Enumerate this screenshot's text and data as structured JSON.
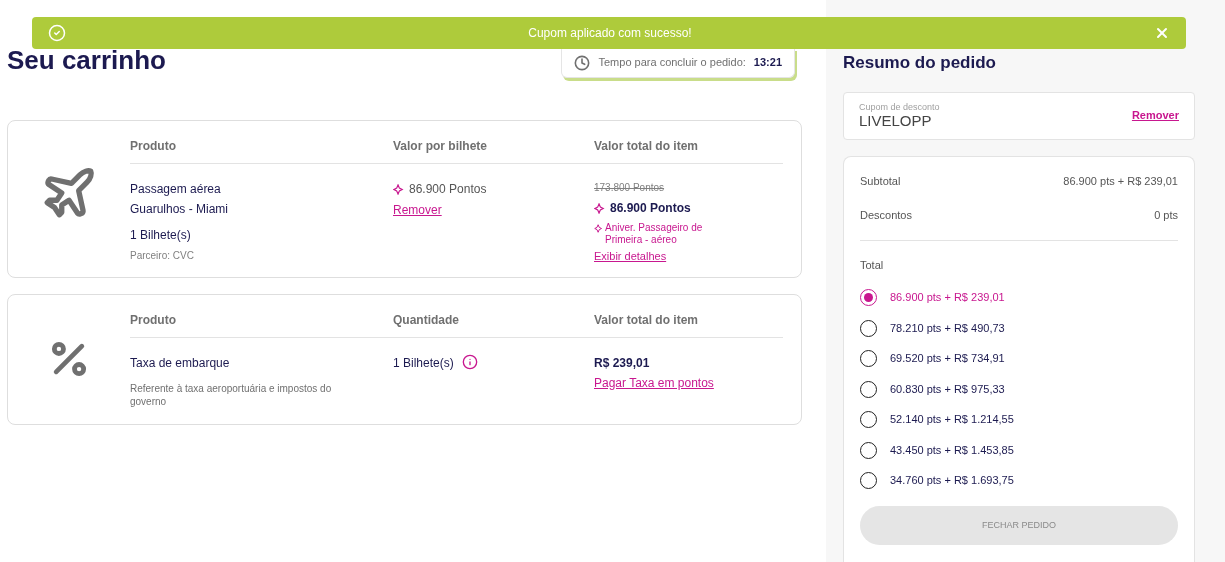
{
  "toast": {
    "message": "Cupom aplicado com sucesso!"
  },
  "cart": {
    "title": "Seu carrinho",
    "timer": {
      "label": "Tempo para concluir o pedido:",
      "value": "13:21"
    },
    "items": [
      {
        "kind": "flight",
        "columns": [
          "Produto",
          "Valor por bilhete",
          "Valor total do item"
        ],
        "name": "Passagem aérea",
        "route": "Guarulhos - Miami",
        "quantity": "1 Bilhete(s)",
        "partner": "Parceiro: CVC",
        "unit_price": "86.900 Pontos",
        "remove": "Remover",
        "old_total": "173.800 Pontos",
        "total": "86.900 Pontos",
        "promo": "Aniver. Passageiro de Primeira - aéreo",
        "details": "Exibir detalhes"
      },
      {
        "kind": "tax",
        "columns": [
          "Produto",
          "Quantidade",
          "Valor total do item"
        ],
        "name": "Taxa de embarque",
        "description": "Referente à taxa aeroportuária e impostos do governo",
        "quantity": "1 Bilhete(s)",
        "total": "R$ 239,01",
        "pay_link": "Pagar Taxa em pontos"
      }
    ]
  },
  "summary": {
    "title": "Resumo do pedido",
    "coupon": {
      "label": "Cupom de desconto",
      "value": "LIVELOPP",
      "remove": "Remover"
    },
    "subtotal": {
      "label": "Subtotal",
      "value": "86.900 pts + R$ 239,01"
    },
    "discounts": {
      "label": "Descontos",
      "value": "0 pts"
    },
    "total_label": "Total",
    "options": [
      {
        "label": "86.900 pts + R$ 239,01",
        "selected": true
      },
      {
        "label": "78.210 pts + R$ 490,73",
        "selected": false
      },
      {
        "label": "69.520 pts + R$ 734,91",
        "selected": false
      },
      {
        "label": "60.830 pts + R$ 975,33",
        "selected": false
      },
      {
        "label": "52.140 pts + R$ 1.214,55",
        "selected": false
      },
      {
        "label": "43.450 pts + R$ 1.453,85",
        "selected": false
      },
      {
        "label": "34.760 pts + R$ 1.693,75",
        "selected": false
      }
    ],
    "checkout": {
      "label": "FECHAR PEDIDO",
      "disabled": true
    }
  }
}
